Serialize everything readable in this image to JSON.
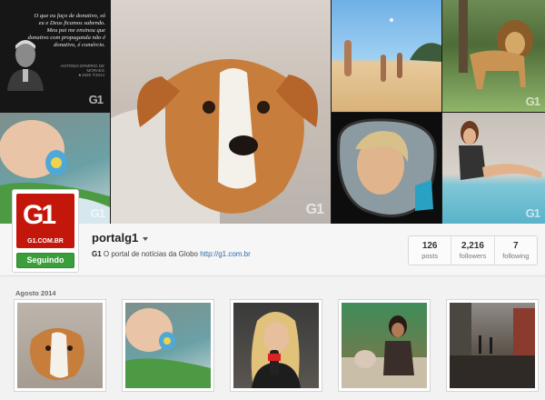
{
  "cover": {
    "quote": {
      "text": "O que eu faço de donativo, só eu e Deus ficamos sabendo. Meu pai me ensinou que donativo com propaganda não é donativo, é comércio.",
      "author": "ANTÔNIO ERMÍRIO DE MORAES",
      "dates": "★1928 ✝2014"
    },
    "watermark": "G1"
  },
  "profile": {
    "avatar_brand": "G1",
    "avatar_domain": "G1.COM.BR",
    "follow_label": "Seguindo",
    "username": "portalg1",
    "bio_name": "G1",
    "bio_text": "O portal de notícias da Globo",
    "bio_link": "http://g1.com.br",
    "stats": [
      {
        "value": "126",
        "label": "posts"
      },
      {
        "value": "2,216",
        "label": "followers"
      },
      {
        "value": "7",
        "label": "following"
      }
    ]
  },
  "feed": {
    "month_label": "Agosto 2014",
    "items": [
      {
        "name": "dog-photo"
      },
      {
        "name": "baby-photo"
      },
      {
        "name": "reporter-photo"
      },
      {
        "name": "women-couch-photo"
      },
      {
        "name": "flooded-street-photo"
      }
    ]
  },
  "colors": {
    "brand_red": "#c4170c",
    "follow_green": "#3a9e3a",
    "link_blue": "#2b6aa8"
  },
  "icons": [
    "dropdown-caret-icon",
    "g1-logo"
  ]
}
